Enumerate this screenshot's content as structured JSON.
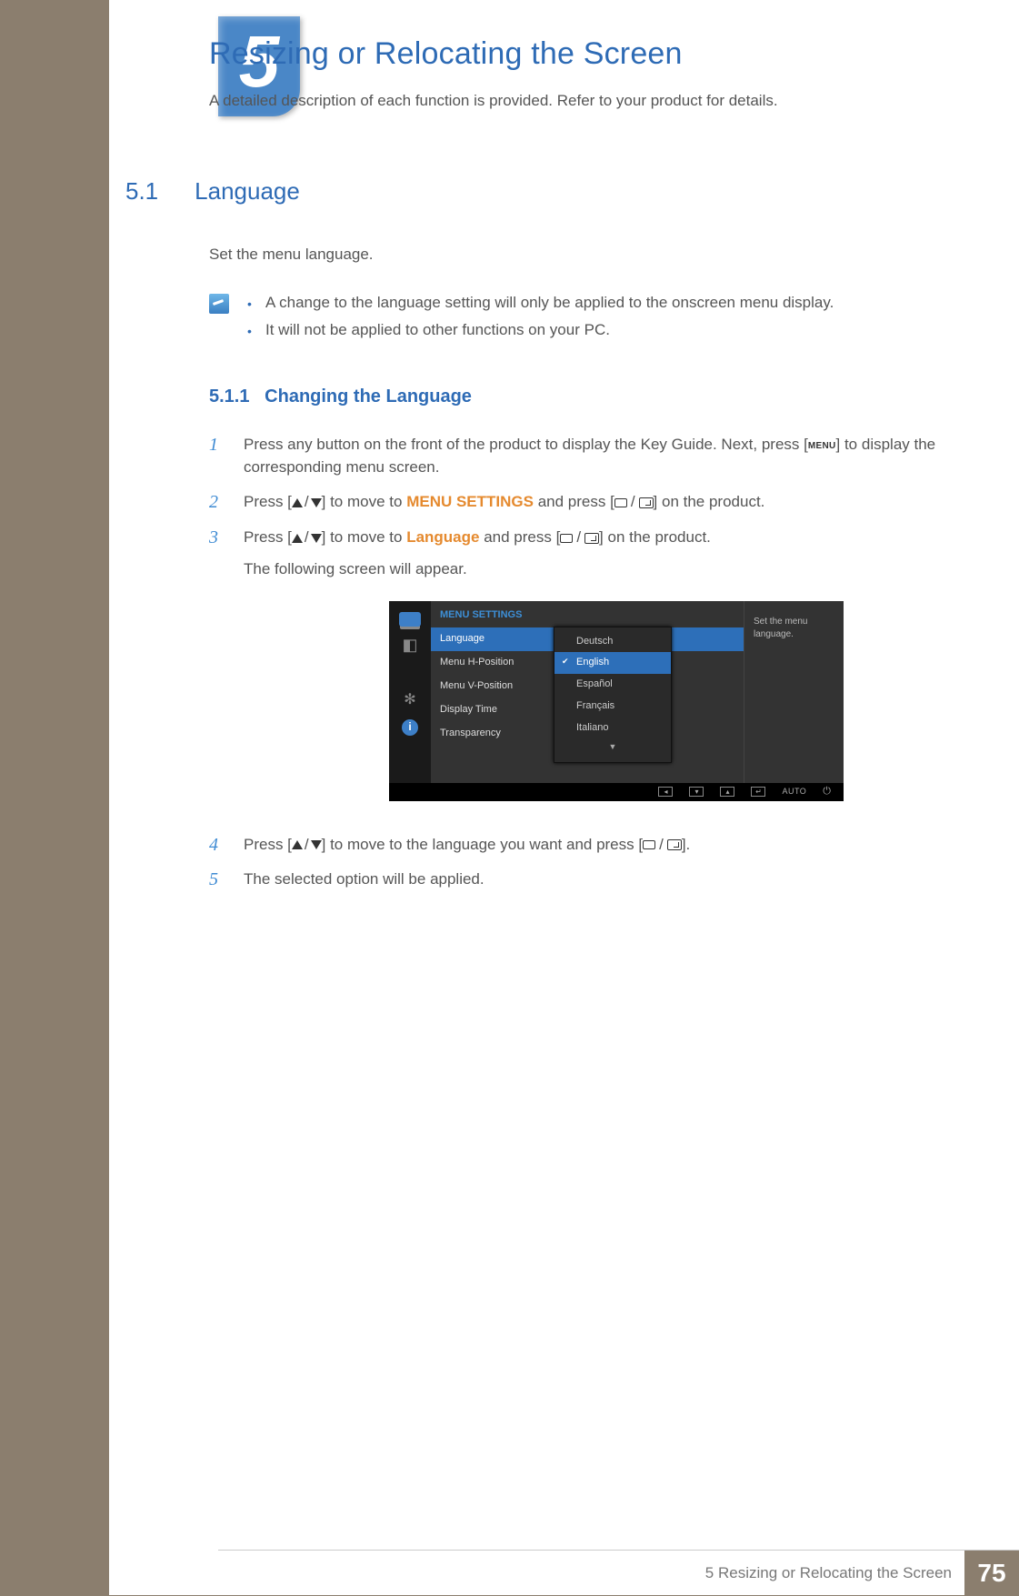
{
  "chapter": {
    "number": "5",
    "title": "Resizing or Relocating the Screen",
    "subtitle": "A detailed description of each function is provided. Refer to your product for details."
  },
  "section": {
    "number": "5.1",
    "title": "Language",
    "intro": "Set the menu language.",
    "notes": [
      "A change to the language setting will only be applied to the onscreen menu display.",
      "It will not be applied to other functions on your PC."
    ]
  },
  "subsection": {
    "number": "5.1.1",
    "title": "Changing the Language"
  },
  "steps": {
    "s1a": "Press any button on the front of the product to display the Key Guide. Next, press [",
    "s1b": "] to display the corresponding menu screen.",
    "menu_glyph": "MENU",
    "s2a": "Press [",
    "s2b": "] to move to ",
    "s2_highlight": "MENU SETTINGS",
    "s2c": " and press [",
    "s2d": "] on the product.",
    "s3a": "Press [",
    "s3b": "] to move to ",
    "s3_highlight": "Language",
    "s3c": " and press [",
    "s3d": "] on the product.",
    "s3_sub": "The following screen will appear.",
    "s4a": "Press [",
    "s4b": "] to move to the language you want and press [",
    "s4c": "].",
    "s5": "The selected option will be applied."
  },
  "osd": {
    "header": "MENU SETTINGS",
    "menu_items": [
      "Language",
      "Menu H-Position",
      "Menu V-Position",
      "Display Time",
      "Transparency"
    ],
    "submenu": [
      "Deutsch",
      "English",
      "Español",
      "Français",
      "Italiano"
    ],
    "selected_submenu": "English",
    "desc": "Set the menu language.",
    "footer_auto": "AUTO"
  },
  "footer": {
    "title": "5 Resizing or Relocating the Screen",
    "page": "75"
  }
}
